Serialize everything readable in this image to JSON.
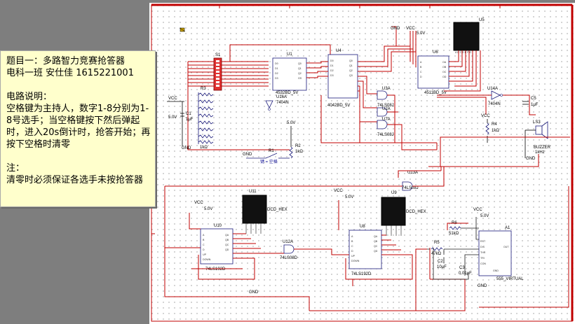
{
  "note": {
    "title_line": "题目一：多路智力竞赛抢答器",
    "author_line": "电科一班  安仕佳  1615221001",
    "desc_heading": "电路说明：",
    "desc_body": "空格键为主持人，数字1-8分别为1-8号选手；当空格键按下然后弹起时，进入20s倒计时，抢答开始；再按下空格时清零",
    "warn_heading": "注：",
    "warn_body": "清零时必须保证各选手未按抢答器"
  },
  "schematic": {
    "components": {
      "s1": "S1",
      "u1": "U1",
      "u1_part": "4532BD_5V",
      "u4": "U4",
      "u4_part": "4042BD_5V",
      "u6": "U6",
      "u6_part": "4511BD_5V",
      "u5": "U5",
      "u16": "U16A",
      "u16_part": "7404N",
      "u14": "U14A",
      "u14_part": "7404N",
      "u2": "U2A",
      "u2_part": "74LS08J",
      "u3": "U3A",
      "u3_part": "74LS08J",
      "u7": "U7A",
      "u7_part": "74LS08J",
      "u13": "U13A",
      "u13_part": "74LS08J",
      "u12": "U12A",
      "u12_part": "74LS08D",
      "u10": "U10",
      "u10_part": "74LS192D",
      "u8": "U8",
      "u8_part": "74LS192D",
      "u11": "U11",
      "u9": "U9",
      "dcd_part": "DCD_HEX",
      "a1": "A1",
      "a1_part": "555_VIRTUAL",
      "r3": "R3",
      "r3_val": "1kΩ",
      "r1": "R1",
      "r1_key": "键 = 空格",
      "r2": "R2",
      "r2_val": "1kΩ",
      "r4": "R4",
      "r4_val": "1kΩ",
      "r5": "R5",
      "r5_val": "47kΩ",
      "r6": "R6",
      "r6_val": "51kΩ",
      "c1": "C1",
      "c1_val": "1μF",
      "c2": "C2",
      "c2_val": "10μF",
      "c3": "C3",
      "c3_val": "0.01μF",
      "c5": "C5",
      "c5_val": "1μF",
      "ls3": "LS3",
      "ls3_part": "BUZZER",
      "ls3_freq": "1kHz"
    },
    "power": {
      "vcc": "VCC",
      "gnd": "GND",
      "v5": "5.0V"
    }
  }
}
